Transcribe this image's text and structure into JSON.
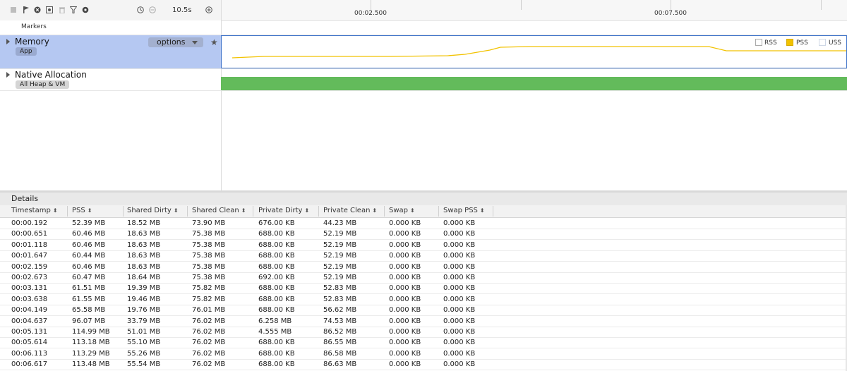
{
  "toolbar": {
    "icons": [
      "stop-icon",
      "flag-icon",
      "record-icon",
      "capture-icon",
      "trash-icon",
      "filter-icon",
      "settings-icon",
      "clock-icon",
      "zoom-out-icon",
      "zoom-in-icon"
    ],
    "zoom_label": "10.5s"
  },
  "ruler": {
    "ticks": [
      "00:02.500",
      "00:07.500"
    ]
  },
  "markers": {
    "label": "Markers"
  },
  "memory_track": {
    "title": "Memory",
    "tag": "App",
    "options_label": "options",
    "legend": [
      {
        "name": "RSS",
        "color": "#ffffff",
        "checked": false
      },
      {
        "name": "PSS",
        "color": "#f2c200",
        "checked": true
      },
      {
        "name": "USS",
        "color": "#ffffff",
        "checked": false
      }
    ],
    "line_color": "#f2c200"
  },
  "native_track": {
    "title": "Native Allocation",
    "tag": "All Heap & VM",
    "bar_color": "#63bb5b"
  },
  "details": {
    "title": "Details",
    "columns": [
      "Timestamp",
      "PSS",
      "Shared Dirty",
      "Shared Clean",
      "Private Dirty",
      "Private Clean",
      "Swap",
      "Swap PSS"
    ],
    "rows": [
      [
        "00:00.192",
        "52.39 MB",
        "18.52 MB",
        "73.90 MB",
        "676.00 KB",
        "44.23 MB",
        "0.000 KB",
        "0.000 KB"
      ],
      [
        "00:00.651",
        "60.46 MB",
        "18.63 MB",
        "75.38 MB",
        "688.00 KB",
        "52.19 MB",
        "0.000 KB",
        "0.000 KB"
      ],
      [
        "00:01.118",
        "60.46 MB",
        "18.63 MB",
        "75.38 MB",
        "688.00 KB",
        "52.19 MB",
        "0.000 KB",
        "0.000 KB"
      ],
      [
        "00:01.647",
        "60.44 MB",
        "18.63 MB",
        "75.38 MB",
        "688.00 KB",
        "52.19 MB",
        "0.000 KB",
        "0.000 KB"
      ],
      [
        "00:02.159",
        "60.46 MB",
        "18.63 MB",
        "75.38 MB",
        "688.00 KB",
        "52.19 MB",
        "0.000 KB",
        "0.000 KB"
      ],
      [
        "00:02.673",
        "60.47 MB",
        "18.64 MB",
        "75.38 MB",
        "692.00 KB",
        "52.19 MB",
        "0.000 KB",
        "0.000 KB"
      ],
      [
        "00:03.131",
        "61.51 MB",
        "19.39 MB",
        "75.82 MB",
        "688.00 KB",
        "52.83 MB",
        "0.000 KB",
        "0.000 KB"
      ],
      [
        "00:03.638",
        "61.55 MB",
        "19.46 MB",
        "75.82 MB",
        "688.00 KB",
        "52.83 MB",
        "0.000 KB",
        "0.000 KB"
      ],
      [
        "00:04.149",
        "65.58 MB",
        "19.76 MB",
        "76.01 MB",
        "688.00 KB",
        "56.62 MB",
        "0.000 KB",
        "0.000 KB"
      ],
      [
        "00:04.637",
        "96.07 MB",
        "33.79 MB",
        "76.02 MB",
        "6.258 MB",
        "74.53 MB",
        "0.000 KB",
        "0.000 KB"
      ],
      [
        "00:05.131",
        "114.99 MB",
        "51.01 MB",
        "76.02 MB",
        "4.555 MB",
        "86.52 MB",
        "0.000 KB",
        "0.000 KB"
      ],
      [
        "00:05.614",
        "113.18 MB",
        "55.10 MB",
        "76.02 MB",
        "688.00 KB",
        "86.55 MB",
        "0.000 KB",
        "0.000 KB"
      ],
      [
        "00:06.113",
        "113.29 MB",
        "55.26 MB",
        "76.02 MB",
        "688.00 KB",
        "86.58 MB",
        "0.000 KB",
        "0.000 KB"
      ],
      [
        "00:06.617",
        "113.48 MB",
        "55.54 MB",
        "76.02 MB",
        "688.00 KB",
        "86.63 MB",
        "0.000 KB",
        "0.000 KB"
      ]
    ]
  }
}
